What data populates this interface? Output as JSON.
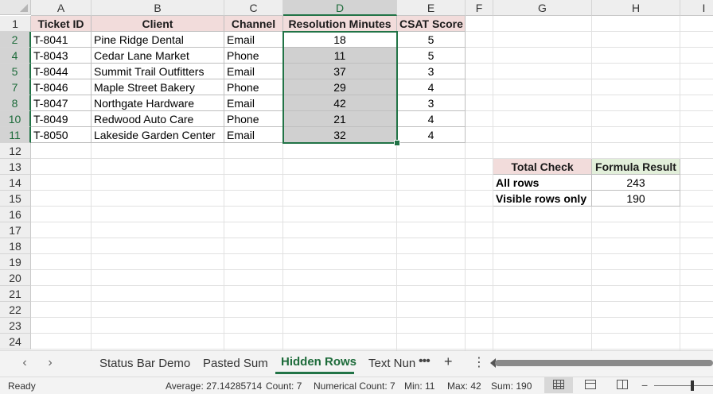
{
  "columns": [
    "A",
    "B",
    "C",
    "D",
    "E",
    "F",
    "G",
    "H",
    "I"
  ],
  "selected_column": "D",
  "rows": [
    "1",
    "2",
    "4",
    "5",
    "7",
    "8",
    "10",
    "11",
    "12",
    "13",
    "14",
    "15",
    "16",
    "17",
    "18",
    "19",
    "20",
    "21",
    "22",
    "23",
    "24"
  ],
  "selected_rows": [
    "2",
    "4",
    "5",
    "7",
    "8",
    "10",
    "11"
  ],
  "table": {
    "headers": [
      "Ticket ID",
      "Client",
      "Channel",
      "Resolution Minutes",
      "CSAT Score"
    ],
    "records": [
      [
        "T-8041",
        "Pine Ridge Dental",
        "Email",
        "18",
        "5"
      ],
      [
        "T-8043",
        "Cedar Lane Market",
        "Phone",
        "11",
        "5"
      ],
      [
        "T-8044",
        "Summit Trail Outfitters",
        "Email",
        "37",
        "3"
      ],
      [
        "T-8046",
        "Maple Street Bakery",
        "Phone",
        "29",
        "4"
      ],
      [
        "T-8047",
        "Northgate Hardware",
        "Email",
        "42",
        "3"
      ],
      [
        "T-8049",
        "Redwood Auto Care",
        "Phone",
        "21",
        "4"
      ],
      [
        "T-8050",
        "Lakeside Garden Center",
        "Email",
        "32",
        "4"
      ]
    ]
  },
  "check": {
    "header_label": "Total Check",
    "header_result": "Formula Result",
    "rows": [
      [
        "All rows",
        "243"
      ],
      [
        "Visible rows only",
        "190"
      ]
    ]
  },
  "sheet_tabs": [
    "Status Bar Demo",
    "Pasted Sum",
    "Hidden Rows",
    "Text Nun"
  ],
  "active_tab": "Hidden Rows",
  "status": {
    "mode": "Ready",
    "average": "Average: 27.14285714",
    "count": "Count: 7",
    "numerical_count": "Numerical Count: 7",
    "min": "Min: 11",
    "max": "Max: 42",
    "sum": "Sum: 190"
  },
  "colors": {
    "accent": "#217346",
    "header_pink": "#f2dcdb",
    "header_green": "#e2efda",
    "selection_fill": "#d0d0d0"
  }
}
